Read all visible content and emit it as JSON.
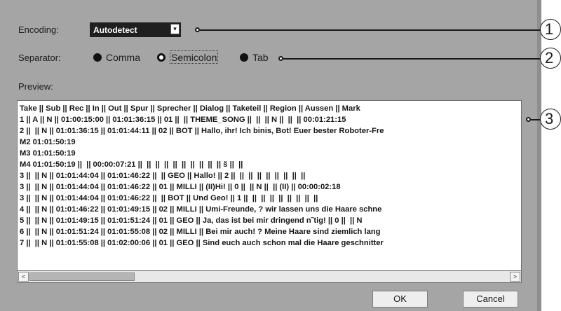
{
  "encoding": {
    "label": "Encoding:",
    "value": "Autodetect",
    "arrow": "▾"
  },
  "separator": {
    "label": "Separator:",
    "options": [
      {
        "label": "Comma"
      },
      {
        "label": "Semicolon"
      },
      {
        "label": "Tab"
      }
    ]
  },
  "preview": {
    "label": "Preview:",
    "lines": [
      "Take || Sub || Rec || In || Out || Spur || Sprecher || Dialog || Taketeil || Region || Aussen || Mark",
      "1 || A || N || 01:00:15:00 || 01:01:36:15 || 01 ||  || THEME_SONG ||  ||  || N ||  ||  || 00:01:21:15",
      "2 ||  || N || 01:01:36:15 || 01:01:44:11 || 02 || BOT || Hallo, ihr! Ich binis, Bot! Euer bester Roboter-Fre",
      "M2 01:01:50:19",
      "M3 01:01:50:19",
      "M4 01:01:50:19 ||  || 00:00:07:21 ||  ||  ||  ||  ||  ||  ||  ||  ||  || š ||  ||",
      "3 ||  || N || 01:01:44:04 || 01:01:46:22 ||  || GEO || Hallo! || 2 ||  ||  ||  ||  ||  ||  ||  ||  ||",
      "3 ||  || N || 01:01:44:04 || 01:01:46:22 || 01 || MILLI || (II)Hi! || 0 ||  || N ||  || (II) || 00:00:02:18",
      "3 ||  || N || 01:01:44:04 || 01:01:46:22 ||  || BOT || Und Geo! || 1 ||  ||  ||  ||  ||  ||  ||  ||  ||",
      "4 ||  || N || 01:01:46:22 || 01:01:49:15 || 02 || MILLI || Umi-Freunde, ? wir lassen uns die Haare schne",
      "5 ||  || N || 01:01:49:15 || 01:01:51:24 || 01 || GEO || Ja, das ist bei mir dringend n˜tig! || 0 ||  || N",
      "6 ||  || N || 01:01:51:24 || 01:01:55:08 || 02 || MILLI || Bei mir auch! ? Meine Haare sind ziemlich lang",
      "7 ||  || N || 01:01:55:08 || 01:02:00:06 || 01 || GEO || Sind euch auch schon mal die Haare geschnitter"
    ]
  },
  "scrollbar": {
    "left_arrow": "<",
    "right_arrow": ">"
  },
  "buttons": {
    "ok": "OK",
    "cancel": "Cancel"
  },
  "callouts": [
    "1",
    "2",
    "3"
  ]
}
